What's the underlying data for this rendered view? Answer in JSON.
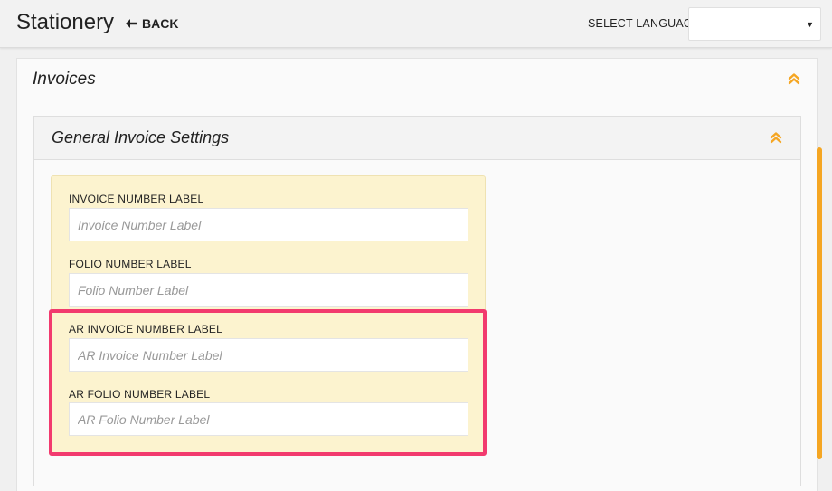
{
  "header": {
    "title": "Stationery",
    "back_label": "BACK",
    "language_label": "SELECT LANGUAGE",
    "language_value": ""
  },
  "invoices_panel": {
    "title": "Invoices"
  },
  "settings_panel": {
    "title": "General Invoice Settings",
    "fields": [
      {
        "label": "INVOICE NUMBER LABEL",
        "placeholder": "Invoice Number Label",
        "value": ""
      },
      {
        "label": "FOLIO NUMBER LABEL",
        "placeholder": "Folio Number Label",
        "value": ""
      },
      {
        "label": "AR INVOICE NUMBER LABEL",
        "placeholder": "AR Invoice Number Label",
        "value": ""
      },
      {
        "label": "AR FOLIO NUMBER LABEL",
        "placeholder": "AR Folio Number Label",
        "value": ""
      }
    ]
  },
  "icons": {
    "collapse": "chevron-double-up-icon",
    "back": "arrow-left-icon",
    "dropdown": "caret-down-icon"
  },
  "colors": {
    "accent": "#f5a623",
    "highlight": "#f23a6e",
    "form_background": "#fcf3cf"
  }
}
